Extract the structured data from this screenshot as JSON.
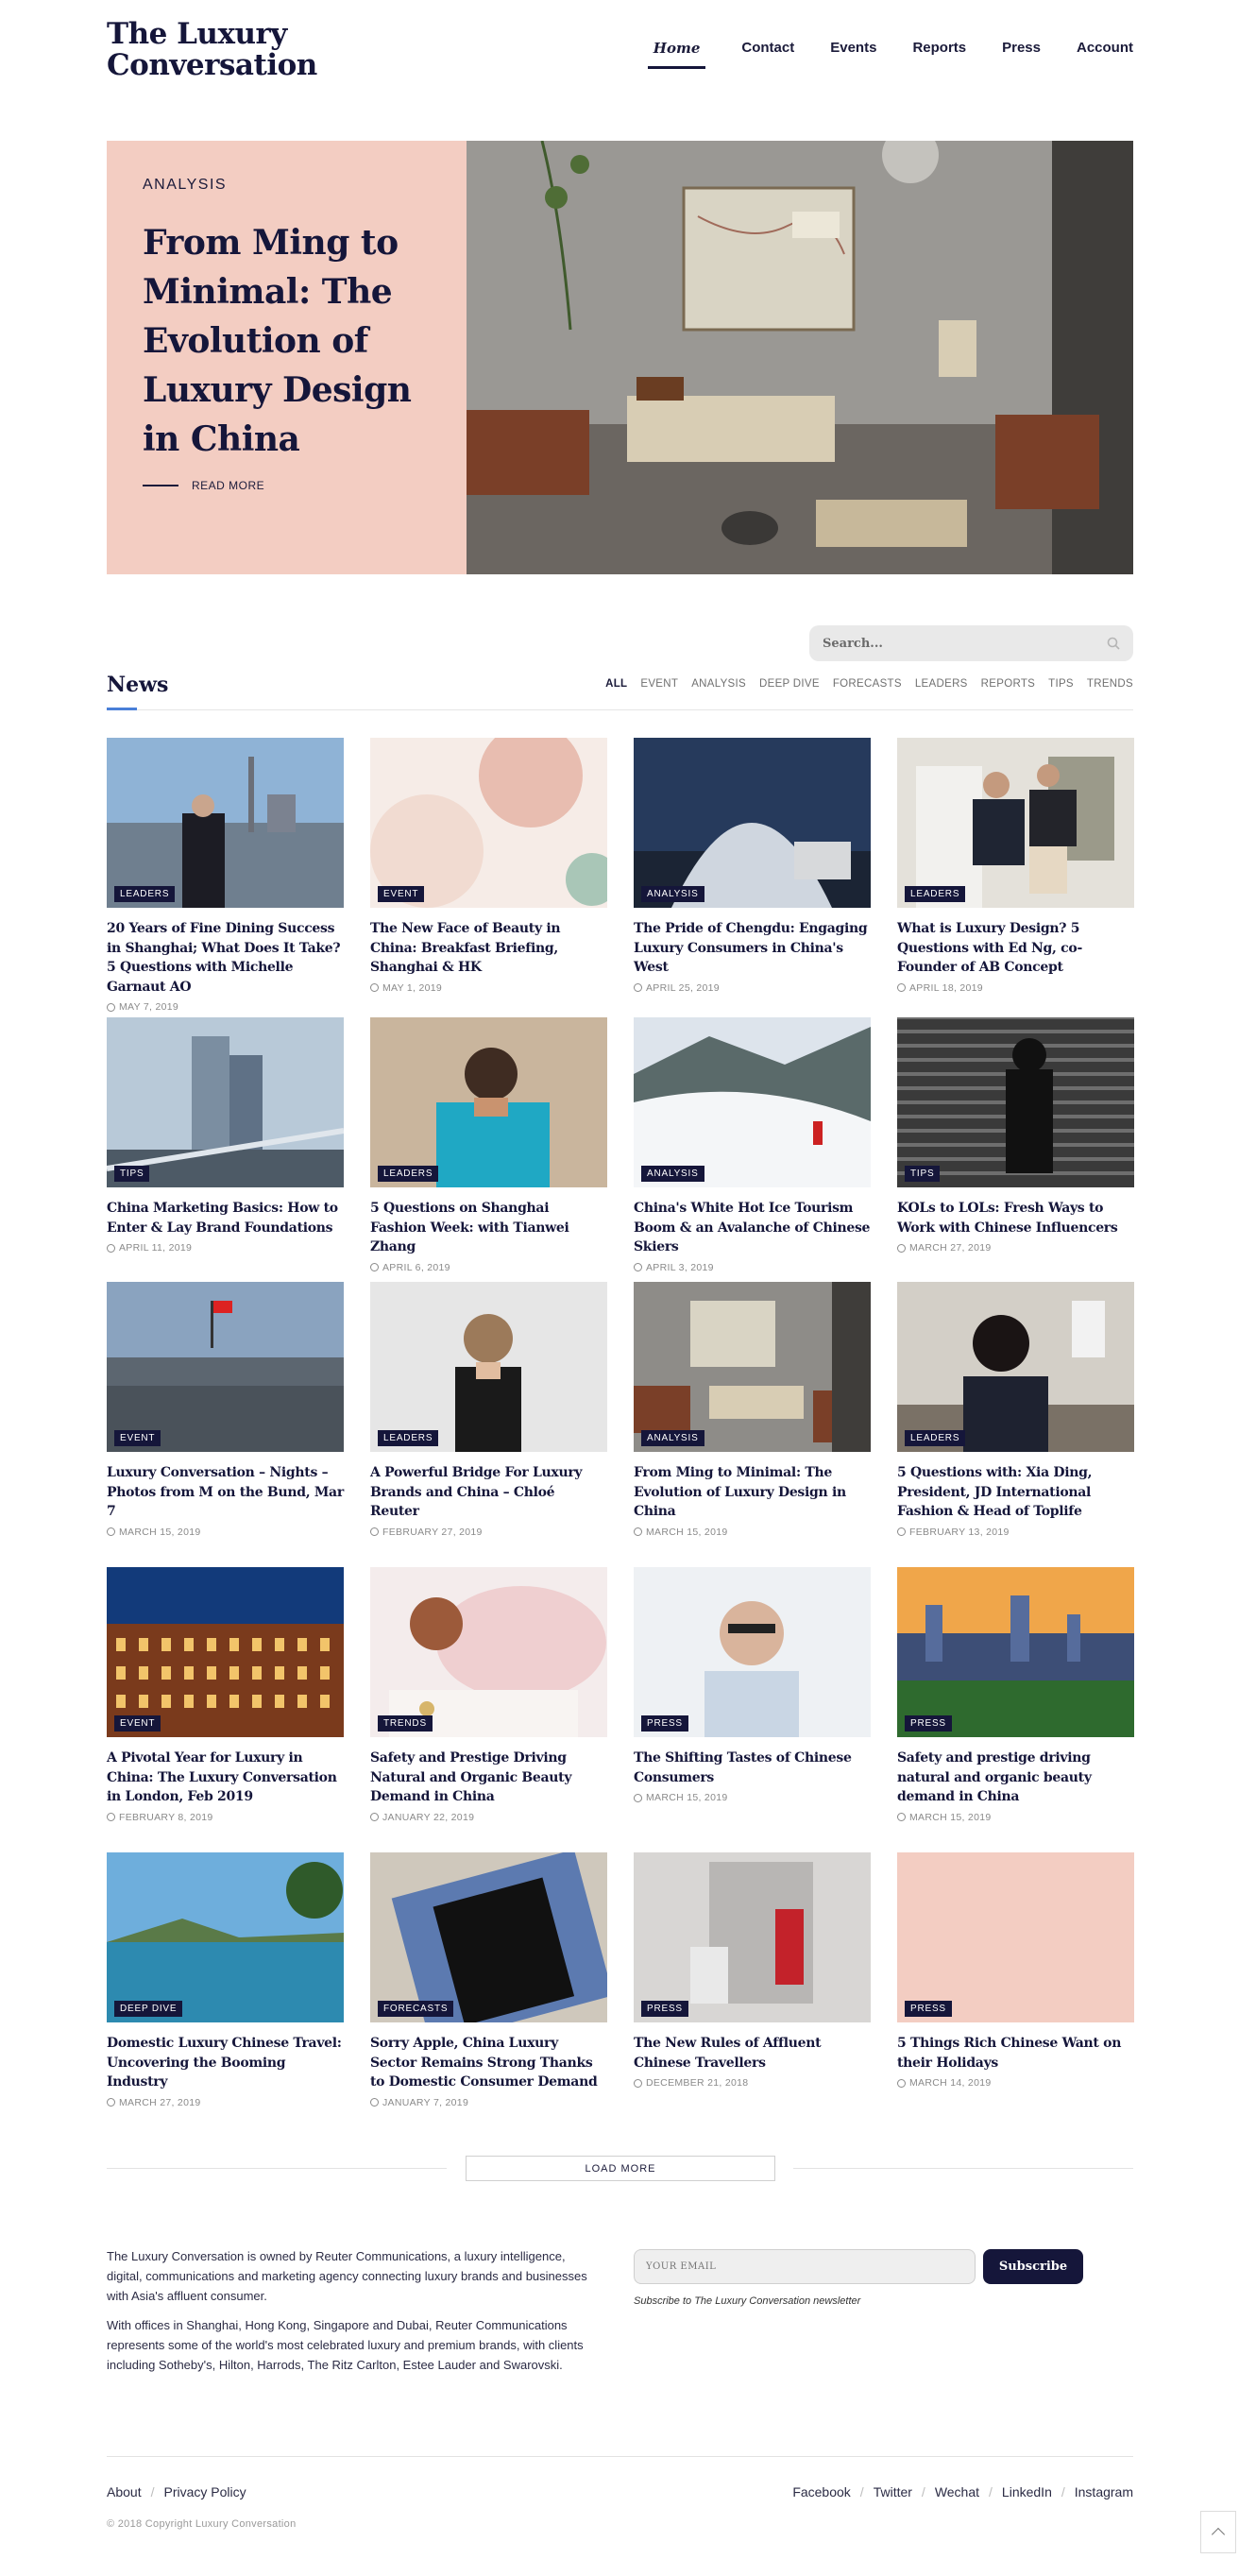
{
  "header": {
    "logo_line1": "The Luxury",
    "logo_line2": "Conversation",
    "nav": [
      "Home",
      "Contact",
      "Events",
      "Reports",
      "Press",
      "Account"
    ]
  },
  "hero": {
    "category": "ANALYSIS",
    "title": "From Ming to Minimal: The Evolution of Luxury Design in China",
    "read_more": "READ MORE"
  },
  "search": {
    "placeholder": "Search..."
  },
  "news": {
    "title": "News",
    "filters": [
      "ALL",
      "EVENT",
      "ANALYSIS",
      "DEEP DIVE",
      "FORECASTS",
      "LEADERS",
      "REPORTS",
      "TIPS",
      "TRENDS"
    ]
  },
  "cards": [
    {
      "tag": "LEADERS",
      "title": "20 Years of Fine Dining Success in Shanghai; What Does It Take? 5 Questions with Michelle Garnaut AO",
      "date": "MAY 7, 2019"
    },
    {
      "tag": "EVENT",
      "title": "The New Face of Beauty in China: Breakfast Briefing, Shanghai & HK",
      "date": "MAY 1, 2019"
    },
    {
      "tag": "ANALYSIS",
      "title": "The Pride of Chengdu: Engaging Luxury Consumers in China's West",
      "date": "APRIL 25, 2019"
    },
    {
      "tag": "LEADERS",
      "title": "What is Luxury Design? 5 Questions with Ed Ng, co-Founder of AB Concept",
      "date": "APRIL 18, 2019"
    },
    {
      "tag": "TIPS",
      "title": "China Marketing Basics: How to Enter & Lay Brand Foundations",
      "date": "APRIL 11, 2019"
    },
    {
      "tag": "LEADERS",
      "title": "5 Questions on Shanghai Fashion Week: with Tianwei Zhang",
      "date": "APRIL 6, 2019"
    },
    {
      "tag": "ANALYSIS",
      "title": "China's White Hot Ice Tourism Boom & an Avalanche of Chinese Skiers",
      "date": "APRIL 3, 2019"
    },
    {
      "tag": "TIPS",
      "title": "KOLs to LOLs: Fresh Ways to Work with Chinese Influencers",
      "date": "MARCH 27, 2019"
    },
    {
      "tag": "EVENT",
      "title": "Luxury Conversation – Nights – Photos from M on the Bund, Mar 7",
      "date": "MARCH 15, 2019"
    },
    {
      "tag": "LEADERS",
      "title": "A Powerful Bridge For Luxury Brands and China – Chloé Reuter",
      "date": "FEBRUARY 27, 2019"
    },
    {
      "tag": "ANALYSIS",
      "title": "From Ming to Minimal: The Evolution of Luxury Design in China",
      "date": "MARCH 15, 2019"
    },
    {
      "tag": "LEADERS",
      "title": "5 Questions with: Xia Ding, President, JD International Fashion & Head of Toplife",
      "date": "FEBRUARY 13, 2019"
    },
    {
      "tag": "EVENT",
      "title": "A Pivotal Year for Luxury in China: The Luxury Conversation in London, Feb 2019",
      "date": "FEBRUARY 8, 2019"
    },
    {
      "tag": "TRENDS",
      "title": "Safety and Prestige Driving Natural and Organic Beauty Demand in China",
      "date": "JANUARY 22, 2019"
    },
    {
      "tag": "PRESS",
      "title": "The Shifting Tastes of Chinese Consumers",
      "date": "MARCH 15, 2019"
    },
    {
      "tag": "PRESS",
      "title": "Safety and prestige driving natural and organic beauty demand in China",
      "date": "MARCH 15, 2019"
    },
    {
      "tag": "DEEP DIVE",
      "title": "Domestic Luxury Chinese Travel: Uncovering the Booming Industry",
      "date": "MARCH 27, 2019"
    },
    {
      "tag": "FORECASTS",
      "title": "Sorry Apple, China Luxury Sector Remains Strong Thanks to Domestic Consumer Demand",
      "date": "JANUARY 7, 2019"
    },
    {
      "tag": "PRESS",
      "title": "The New Rules of Affluent Chinese Travellers",
      "date": "DECEMBER 21, 2018"
    },
    {
      "tag": "PRESS",
      "title": "5 Things Rich Chinese Want on their Holidays",
      "date": "MARCH 14, 2019"
    }
  ],
  "load_more": "LOAD MORE",
  "footer": {
    "about_p1": "The Luxury Conversation is owned by Reuter Communications, a luxury intelligence, digital, communications and marketing agency connecting luxury brands and businesses with Asia's affluent consumer.",
    "about_p2": "With offices in Shanghai, Hong Kong, Singapore and Dubai, Reuter Communications represents some of the world's most celebrated luxury and premium brands, with clients including Sotheby's, Hilton, Harrods, The Ritz Carlton, Estee Lauder and Swarovski.",
    "email_placeholder": "YOUR EMAIL",
    "subscribe": "Subscribe",
    "subscribe_note": "Subscribe to The Luxury Conversation newsletter",
    "left_links": [
      "About",
      "Privacy Policy"
    ],
    "social_links": [
      "Facebook",
      "Twitter",
      "Wechat",
      "LinkedIn",
      "Instagram"
    ],
    "copyright": "© 2018 Copyright Luxury Conversation"
  }
}
